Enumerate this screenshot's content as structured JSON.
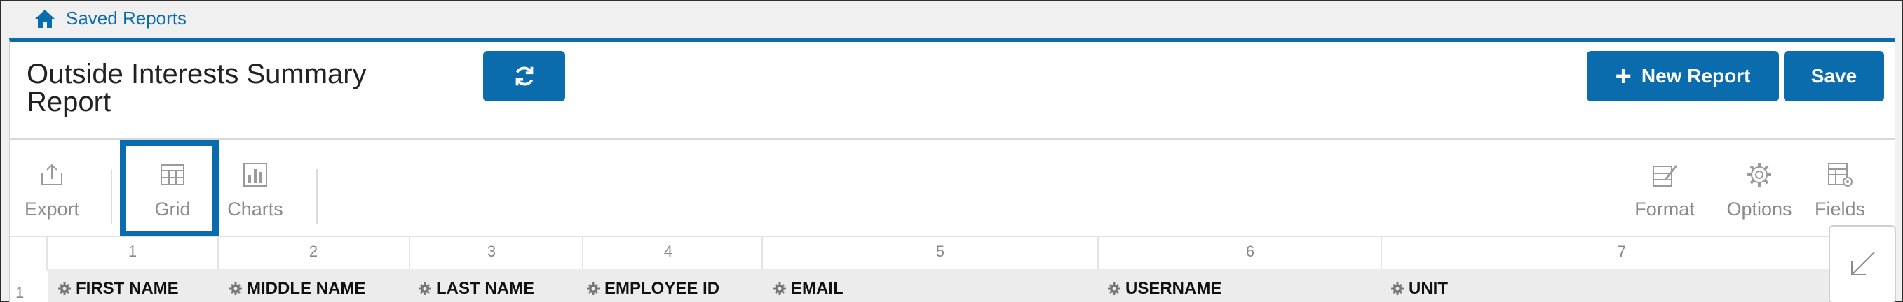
{
  "breadcrumb": {
    "label": "Saved Reports"
  },
  "report": {
    "title": "Outside Interests Summary Report"
  },
  "buttons": {
    "new_report": "New Report",
    "save": "Save"
  },
  "toolbar": {
    "export": "Export",
    "grid": "Grid",
    "charts": "Charts",
    "format": "Format",
    "options": "Options",
    "fields": "Fields"
  },
  "grid": {
    "column_numbers": [
      "1",
      "2",
      "3",
      "4",
      "5",
      "6",
      "7"
    ],
    "row_number": "1",
    "headers": [
      "FIRST NAME",
      "MIDDLE NAME",
      "LAST NAME",
      "EMPLOYEE ID",
      "EMAIL",
      "USERNAME",
      "UNIT"
    ]
  },
  "colors": {
    "accent": "#0a6cad"
  }
}
